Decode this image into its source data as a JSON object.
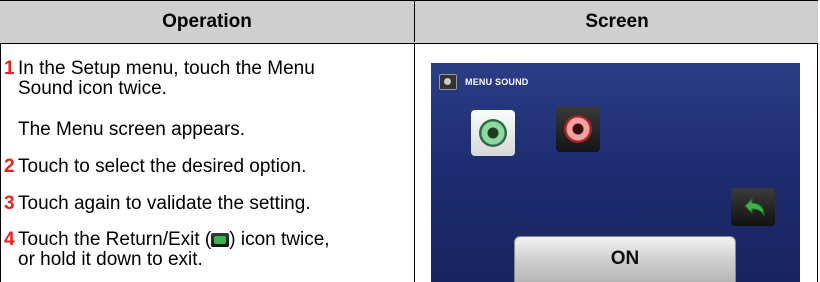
{
  "table": {
    "headers": {
      "operation": "Operation",
      "screen": "Screen"
    }
  },
  "steps": [
    {
      "num": "1",
      "line1": "In the Setup menu, touch the Menu",
      "line2": "Sound icon twice."
    },
    {
      "num": "",
      "line1": "The Menu screen appears."
    },
    {
      "num": "2",
      "line1": "Touch to select the desired option."
    },
    {
      "num": "3",
      "line1": "Touch again to validate the setting."
    },
    {
      "num": "4",
      "line1_pre": "Touch the Return/Exit (",
      "line1_post": ") icon twice,",
      "line2": "or hold it down to exit."
    }
  ],
  "screen": {
    "title": "MENU SOUND",
    "option_value": "ON",
    "icons": [
      "menu-sound-icon",
      "speaker-on-icon",
      "speaker-off-icon",
      "return-exit-icon"
    ]
  },
  "colors": {
    "step_number": "#e8231c",
    "header_bg": "#cfcfcf",
    "screen_bg": "#1d2c70"
  }
}
